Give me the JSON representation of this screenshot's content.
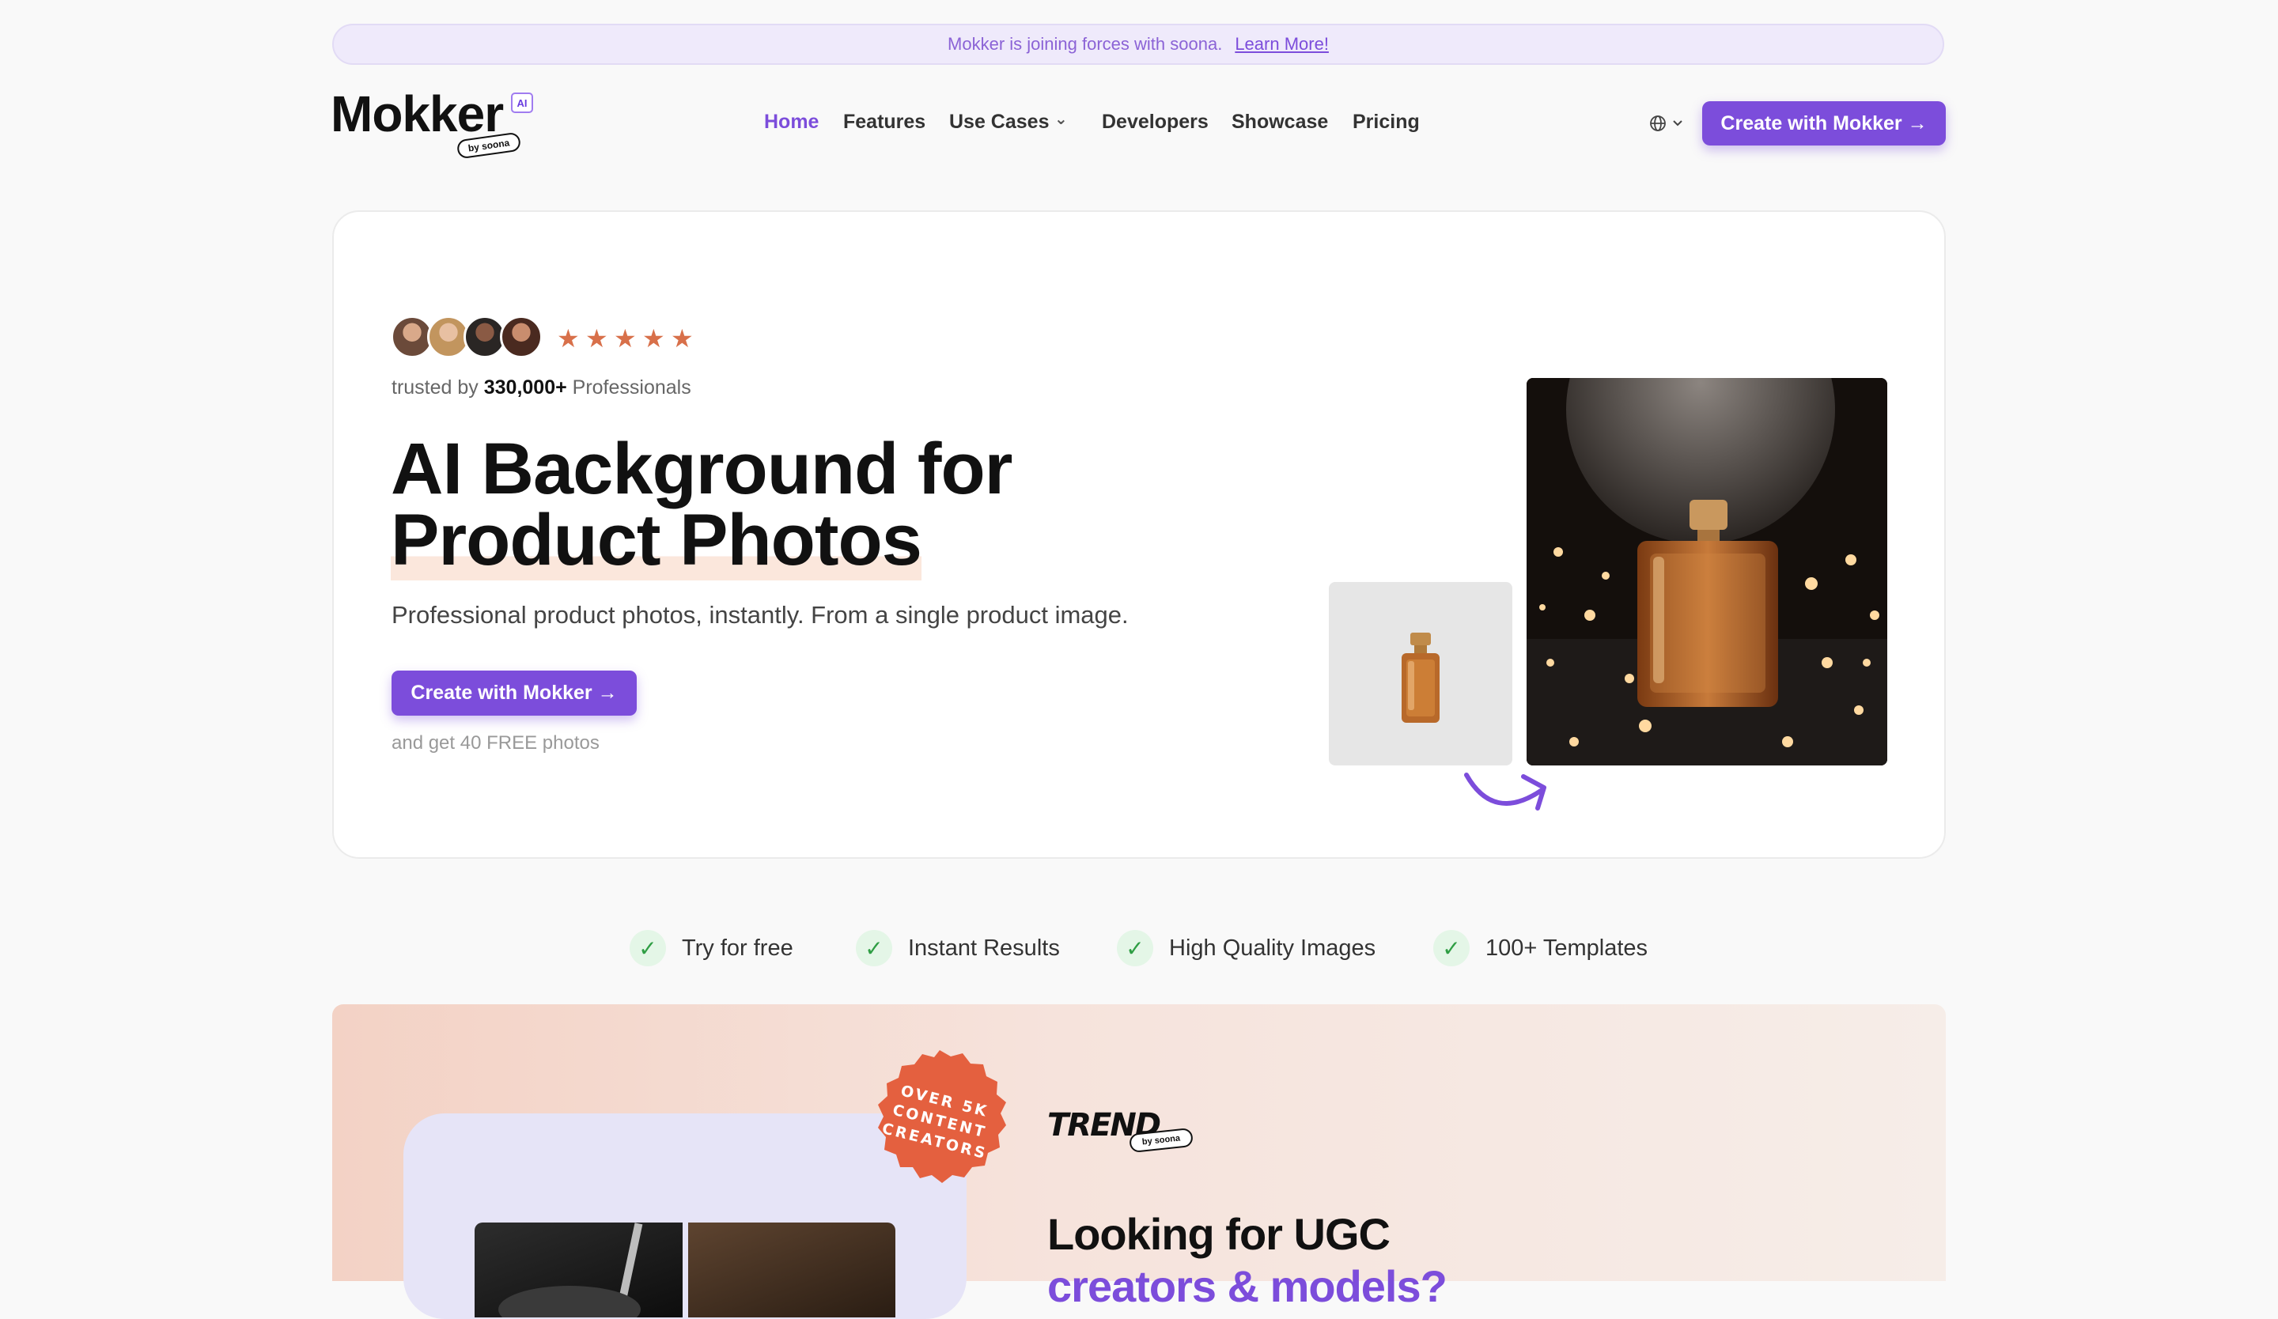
{
  "banner": {
    "text": "Mokker is joining forces with soona.",
    "link": "Learn More!"
  },
  "header": {
    "logo": "Mokker",
    "logo_ai": "AI",
    "logo_badge": "by soona",
    "nav": [
      "Home",
      "Features",
      "Use Cases",
      "Developers",
      "Showcase",
      "Pricing"
    ],
    "active_nav": "Home",
    "language_icon": "globe-icon",
    "cta": "Create with Mokker →"
  },
  "hero": {
    "rating_stars": 5,
    "trusted_prefix": "trusted by",
    "trusted_count": "330,000+",
    "trusted_suffix": "Professionals",
    "title_line1": "AI Background for",
    "title_line2": "Product Photos",
    "subtitle": "Professional product photos, instantly. From a single product image.",
    "cta": "Create with Mokker →",
    "cta_note": "and get 40 FREE photos"
  },
  "features": [
    "Try for free",
    "Instant Results",
    "High Quality Images",
    "100+ Templates"
  ],
  "ugc": {
    "seal_text": "OVER 5K CONTENT CREATORS",
    "brand": "TREND",
    "brand_badge": "by soona",
    "title_line1": "Looking for UGC",
    "title_line2": "creators & models?"
  },
  "colors": {
    "accent": "#7c4ddb",
    "star": "#d8704a",
    "check": "#2f9e44",
    "seal": "#e4603f"
  }
}
